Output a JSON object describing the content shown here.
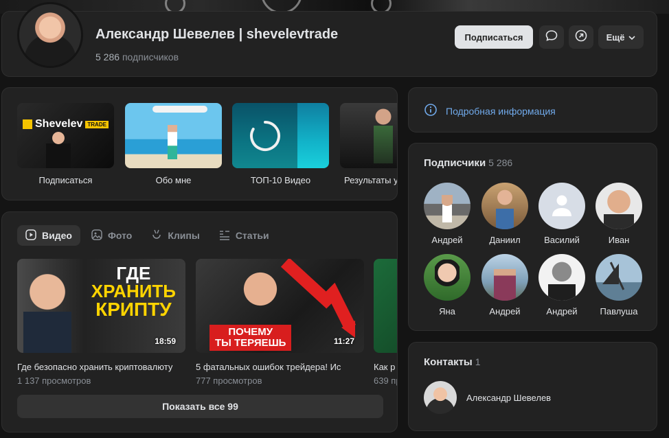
{
  "header": {
    "name": "Александр Шевелев | shevelevtrade",
    "subscribers_count": "5 286",
    "subscribers_word": "подписчиков",
    "subscribe_label": "Подписаться",
    "more_label": "Ещё"
  },
  "highlights": [
    {
      "label": "Подписаться",
      "logo_text": "Shevelev",
      "logo_badge": "TRADE"
    },
    {
      "label": "Обо мне"
    },
    {
      "label": "ТОП-10 Видео"
    },
    {
      "label": "Результаты у"
    }
  ],
  "tabs": [
    {
      "label": "Видео",
      "icon": "play-icon"
    },
    {
      "label": "Фото",
      "icon": "image-icon"
    },
    {
      "label": "Клипы",
      "icon": "clips-icon"
    },
    {
      "label": "Статьи",
      "icon": "article-icon"
    }
  ],
  "videos": [
    {
      "title": "Где безопасно хранить криптовалюту",
      "views": "1 137 просмотров",
      "duration": "18:59",
      "thumb_text": [
        "ГДЕ",
        "ХРАНИТЬ",
        "КРИПТУ"
      ]
    },
    {
      "title": "5 фатальных ошибок трейдера! Ис",
      "views": "777 просмотров",
      "duration": "11:27",
      "thumb_text": [
        "ПОЧЕМУ",
        "ТЫ ТЕРЯЕШЬ"
      ]
    },
    {
      "title": "Как р",
      "views": "639 пр",
      "duration": ""
    }
  ],
  "show_all_label": "Показать все 99",
  "info_label": "Подробная информация",
  "subscribers_section": {
    "title": "Подписчики",
    "count": "5 286",
    "people": [
      {
        "name": "Андрей"
      },
      {
        "name": "Даниил"
      },
      {
        "name": "Василий"
      },
      {
        "name": "Иван"
      },
      {
        "name": "Яна"
      },
      {
        "name": "Андрей"
      },
      {
        "name": "Андрей"
      },
      {
        "name": "Павлуша"
      }
    ]
  },
  "contacts": {
    "title": "Контакты",
    "count": "1",
    "person": "Александр Шевелев"
  },
  "colors": {
    "accent_link": "#71aaeb",
    "card_bg": "#222222",
    "page_bg": "#141414"
  }
}
